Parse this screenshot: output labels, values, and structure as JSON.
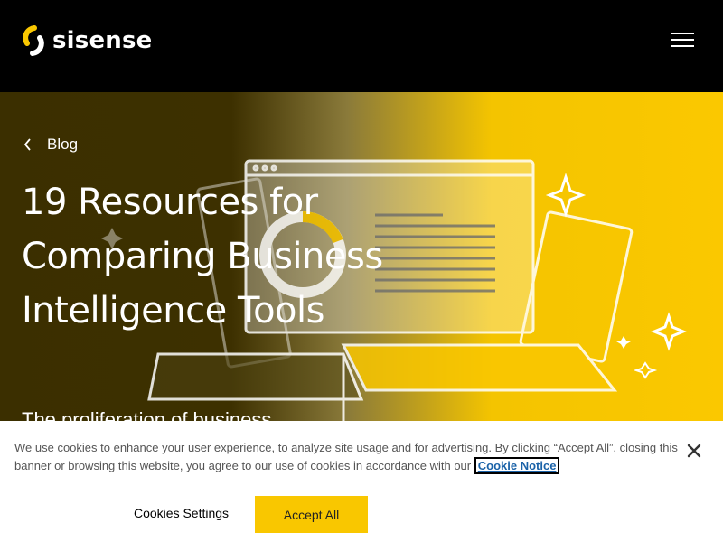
{
  "header": {
    "logo_text": "sisense",
    "menu_icon": "hamburger-menu-icon"
  },
  "hero": {
    "breadcrumb": "Blog",
    "title": "19 Resources for Comparing Business Intelligence Tools",
    "subtitle_partial": "The proliferation of business"
  },
  "cookie_banner": {
    "text": "We use cookies to enhance your user experience, to analyze site usage and for advertising. By clicking “Accept All”, closing this banner or browsing this website, you agree to our use of cookies in accordance with our",
    "link_label": "Cookie Notice",
    "settings_label": "Cookies Settings",
    "accept_label": "Accept All",
    "close_icon": "close-icon"
  },
  "colors": {
    "brand_yellow": "#FBC800",
    "header_bg": "#000000",
    "link_blue": "#1A62A8"
  }
}
